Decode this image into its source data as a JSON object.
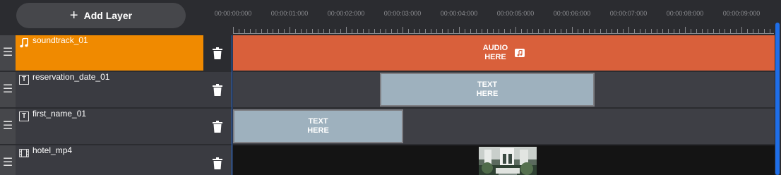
{
  "toolbar": {
    "add_layer_label": "Add Layer",
    "add_layer_icon": "plus-icon"
  },
  "timeline": {
    "tick_labels": [
      "00:00:00:000",
      "00:00:01:000",
      "00:00:02:000",
      "00:00:03:000",
      "00:00:04:000",
      "00:00:05:000",
      "00:00:06:000",
      "00:00:07:000",
      "00:00:08:000",
      "00:00:09:000"
    ],
    "accent_color": "#1e6ee8"
  },
  "layers": [
    {
      "name": "soundtrack_01",
      "type_icon": "music-note-icon",
      "selected": true,
      "selected_color": "#f08a00",
      "clip": {
        "kind": "audio",
        "line1": "AUDIO",
        "line2": "HERE",
        "color": "#d9603b"
      }
    },
    {
      "name": "reservation_date_01",
      "type_icon": "text-icon",
      "type_glyph": "T",
      "clip": {
        "kind": "text",
        "line1": "TEXT",
        "line2": "HERE",
        "color": "#9eb1be"
      }
    },
    {
      "name": "first_name_01",
      "type_icon": "text-icon",
      "type_glyph": "T",
      "clip": {
        "kind": "text",
        "line1": "TEXT",
        "line2": "HERE",
        "color": "#9eb1be"
      }
    },
    {
      "name": "hotel_mp4",
      "type_icon": "film-icon",
      "clip": {
        "kind": "video"
      }
    }
  ],
  "icons": {
    "drag": "drag-handle-icon",
    "delete": "trash-icon"
  }
}
